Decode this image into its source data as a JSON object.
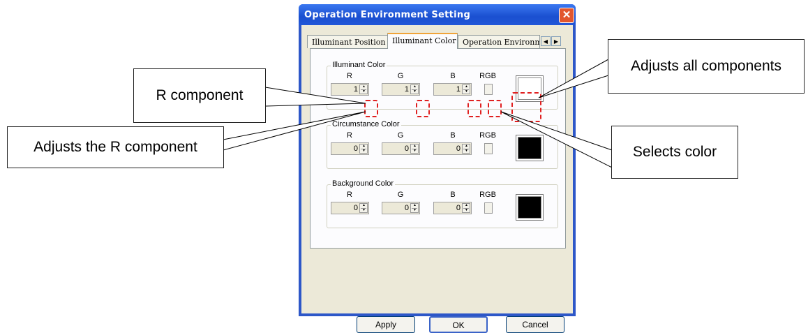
{
  "window": {
    "title": "Operation Environment Setting",
    "close_glyph": "✕"
  },
  "tabs": [
    {
      "label": "Illuminant Position",
      "active": false
    },
    {
      "label": "Illuminant Color",
      "active": true
    },
    {
      "label": "Operation Environme",
      "active": false
    }
  ],
  "tab_scroll": {
    "left": "◀",
    "right": "▶"
  },
  "groups": [
    {
      "title": "Illuminant Color",
      "r": "1",
      "g": "1",
      "b": "1",
      "swatch_color": "#ffffff"
    },
    {
      "title": "Circumstance Color",
      "r": "0",
      "g": "0",
      "b": "0",
      "swatch_color": "#000000"
    },
    {
      "title": "Background Color",
      "r": "0",
      "g": "0",
      "b": "0",
      "swatch_color": "#000000"
    }
  ],
  "column_labels": {
    "r": "R",
    "g": "G",
    "b": "B",
    "rgb": "RGB"
  },
  "buttons": {
    "apply": "Apply",
    "ok": "OK",
    "cancel": "Cancel"
  },
  "callouts": {
    "r_component": "R component",
    "adjust_r": "Adjusts the R component",
    "adjust_all": "Adjusts all components",
    "select_color": "Selects color"
  },
  "colors": {
    "annotation_dash": "#e02020",
    "titlebar": "#2357d6"
  }
}
